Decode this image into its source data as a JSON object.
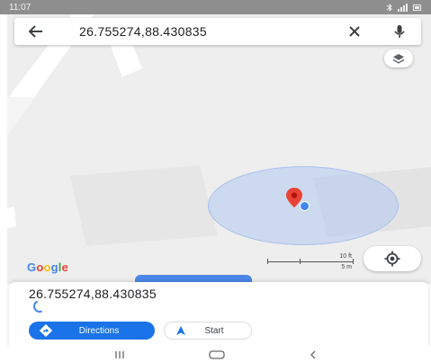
{
  "status_bar": {
    "time": "11:07",
    "right_icons": [
      "bluetooth-icon",
      "signal-icon",
      "battery-icon"
    ]
  },
  "search": {
    "query": "26.755274,88.430835",
    "back_icon": "arrow-left-icon",
    "clear_icon": "close-icon",
    "mic_icon": "microphone-icon"
  },
  "map": {
    "layers_icon": "layers-icon",
    "pin_icon": "map-pin-icon",
    "locate_icon": "my-location-icon",
    "accent_color": "#4285f4",
    "pin_color": "#ea4335"
  },
  "logo": {
    "letters": [
      "G",
      "o",
      "o",
      "g",
      "l",
      "e"
    ],
    "colors": [
      "#4285f4",
      "#ea4335",
      "#fbbc05",
      "#4285f4",
      "#34a853",
      "#ea4335"
    ]
  },
  "scale": {
    "top_label": "10 ft",
    "bottom_label": "5 m"
  },
  "sheet": {
    "coords": "26.755274,88.430835",
    "directions": {
      "label": "Directions",
      "icon": "directions-icon"
    },
    "start": {
      "label": "Start",
      "icon": "navigation-arrow-icon"
    }
  },
  "nav_bar": {
    "icons": [
      "recent-apps-icon",
      "home-icon",
      "back-icon"
    ]
  }
}
